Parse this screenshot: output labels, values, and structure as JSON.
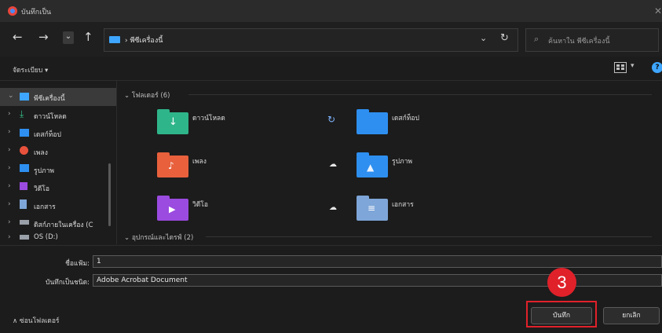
{
  "window": {
    "title": "บันทึกเป็น",
    "close_glyph": "✕"
  },
  "nav": {
    "back": "←",
    "forward": "→",
    "recent": "⌄",
    "up": "↑",
    "breadcrumb": "› พีซีเครื่องนี้",
    "dropdown": "⌄",
    "refresh": "↻",
    "search_placeholder": "ค้นหาใน พีซีเครื่องนี้"
  },
  "toolbar": {
    "organize": "จัดระเบียบ ▾",
    "view_chevron": "▾",
    "help": "?"
  },
  "sidebar": {
    "items": [
      {
        "arrow": "⌄",
        "label": "พีซีเครื่องนี้",
        "icon": "pc-icon",
        "color": "#3ea6ff",
        "selected": true
      },
      {
        "arrow": "›",
        "label": "ดาวน์โหลด",
        "icon": "download-icon",
        "color": "#35c28a"
      },
      {
        "arrow": "›",
        "label": "เดสก์ท็อป",
        "icon": "desktop-icon",
        "color": "#2e8ff0"
      },
      {
        "arrow": "›",
        "label": "เพลง",
        "icon": "music-icon",
        "color": "#e8523c"
      },
      {
        "arrow": "›",
        "label": "รูปภาพ",
        "icon": "pictures-icon",
        "color": "#2e8ff0"
      },
      {
        "arrow": "›",
        "label": "วิดีโอ",
        "icon": "video-icon",
        "color": "#9b4be0"
      },
      {
        "arrow": "›",
        "label": "เอกสาร",
        "icon": "documents-icon",
        "color": "#7ea6d8"
      },
      {
        "arrow": "›",
        "label": "ดิสก์ภายในเครื่อง (C",
        "icon": "drive-icon",
        "color": "#9aa0a8"
      },
      {
        "arrow": "›",
        "label": "OS (D:)",
        "icon": "drive-icon",
        "color": "#9aa0a8"
      }
    ]
  },
  "content": {
    "group_folders": "⌄  โฟลเดอร์ (6)",
    "group_devices": "⌄  อุปกรณ์และไดรฟ์ (2)",
    "folders": [
      {
        "name": "ดาวน์โหลด",
        "icon": "download-folder-icon",
        "color": "#2fb58a",
        "glyph": "↓"
      },
      {
        "name": "เดสก์ท็อป",
        "icon": "desktop-folder-icon",
        "color": "#2e8ff0",
        "glyph": "",
        "status": "↻"
      },
      {
        "name": "เพลง",
        "icon": "music-folder-icon",
        "color": "#e8603c",
        "glyph": "♪"
      },
      {
        "name": "รูปภาพ",
        "icon": "pictures-folder-icon",
        "color": "#2e8ff0",
        "glyph": "▲",
        "status": "☁"
      },
      {
        "name": "วิดีโอ",
        "icon": "video-folder-icon",
        "color": "#9b4be0",
        "glyph": "▶"
      },
      {
        "name": "เอกสาร",
        "icon": "documents-folder-icon",
        "color": "#7ea6d8",
        "glyph": "≡",
        "status": "☁"
      }
    ]
  },
  "form": {
    "filename_label": "ชื่อแฟ้ม:",
    "filename_value": "1",
    "filetype_label": "บันทึกเป็นชนิด:",
    "filetype_value": "Adobe Acrobat Document",
    "hide_folders": "∧  ซ่อนโฟลเดอร์",
    "save_button": "บันทึก",
    "cancel_button": "ยกเลิก"
  },
  "annotation": {
    "step": "3",
    "color": "#e0212a"
  }
}
